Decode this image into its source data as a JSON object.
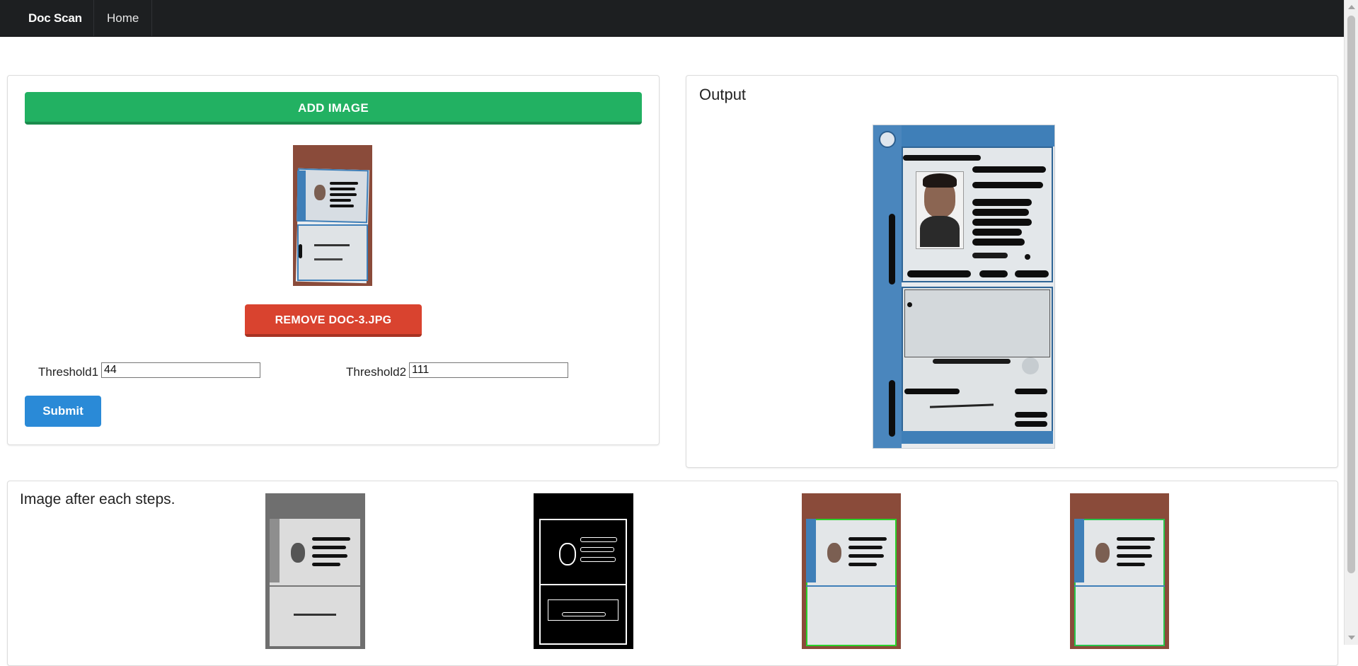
{
  "nav": {
    "brand": "Doc Scan",
    "home": "Home"
  },
  "input_panel": {
    "add_button": "ADD IMAGE",
    "remove_button": "REMOVE DOC-3.JPG",
    "threshold1_label": "Threshold1",
    "threshold1_value": "44",
    "threshold2_label": "Threshold2",
    "threshold2_value": "111",
    "submit_button": "Submit"
  },
  "output_panel": {
    "title": "Output"
  },
  "steps_panel": {
    "title": "Image after each steps."
  },
  "colors": {
    "navbar": "#1d1f21",
    "add_button": "#22b162",
    "remove_button": "#d9432f",
    "submit_button": "#2a8ad7",
    "document_blue": "#3f7fb8",
    "table_brown": "#8a4b3a"
  }
}
